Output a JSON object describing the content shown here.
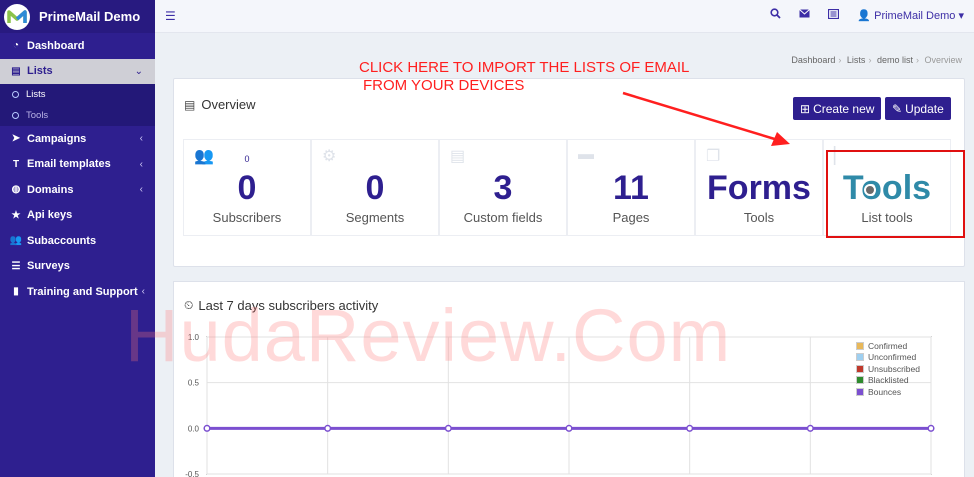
{
  "brand": {
    "title": "PrimeMail Demo"
  },
  "sidebar": {
    "items": [
      {
        "label": "Dashboard"
      },
      {
        "label": "Lists"
      },
      {
        "label": "Campaigns"
      },
      {
        "label": "Email templates"
      },
      {
        "label": "Domains"
      },
      {
        "label": "Api keys"
      },
      {
        "label": "Subaccounts"
      },
      {
        "label": "Surveys"
      },
      {
        "label": "Training and Support"
      }
    ],
    "sub_items": [
      {
        "label": "Lists"
      },
      {
        "label": "Tools"
      }
    ]
  },
  "topbar": {
    "user": "PrimeMail Demo"
  },
  "breadcrumb": [
    "Dashboard",
    "Lists",
    "demo list",
    "Overview"
  ],
  "annotation": {
    "line1": "CLICK HERE TO IMPORT THE LISTS OF EMAIL",
    "line2": "FROM YOUR DEVICES"
  },
  "overview": {
    "title": "Overview",
    "create_label": "Create new",
    "update_label": "Update",
    "stats": [
      {
        "small": "0",
        "value": "0",
        "label": "Subscribers"
      },
      {
        "small": "",
        "value": "0",
        "label": "Segments"
      },
      {
        "small": "",
        "value": "3",
        "label": "Custom fields"
      },
      {
        "small": "",
        "value": "11",
        "label": "Pages"
      },
      {
        "small": "",
        "value": "Forms",
        "label": "Tools"
      },
      {
        "small": "",
        "value": "Tools",
        "label": "List tools"
      }
    ]
  },
  "activity": {
    "title": "Last 7 days subscribers activity"
  },
  "chart_data": {
    "type": "line",
    "title": "Last 7 days subscribers activity",
    "ylim": [
      -0.5,
      1.0
    ],
    "yticks": [
      "1.0",
      "0.5",
      "0.0",
      "-0.5"
    ],
    "x": [
      0,
      1,
      2,
      3,
      4,
      5,
      6
    ],
    "series": [
      {
        "name": "Confirmed",
        "color": "#e8b85a",
        "values": [
          0,
          0,
          0,
          0,
          0,
          0,
          0
        ]
      },
      {
        "name": "Unconfirmed",
        "color": "#9ecff0",
        "values": [
          0,
          0,
          0,
          0,
          0,
          0,
          0
        ]
      },
      {
        "name": "Unsubscribed",
        "color": "#c0392b",
        "values": [
          0,
          0,
          0,
          0,
          0,
          0,
          0
        ]
      },
      {
        "name": "Blacklisted",
        "color": "#2e8b2e",
        "values": [
          0,
          0,
          0,
          0,
          0,
          0,
          0
        ]
      },
      {
        "name": "Bounces",
        "color": "#7b4fd0",
        "values": [
          0,
          0,
          0,
          0,
          0,
          0,
          0
        ]
      }
    ],
    "grid": true,
    "legend": "top-right"
  },
  "watermark": "HudaReview.Com",
  "colors": {
    "primary": "#2e1f8f",
    "annotation": "#ff1f1f",
    "teal": "#2f8aa8"
  }
}
